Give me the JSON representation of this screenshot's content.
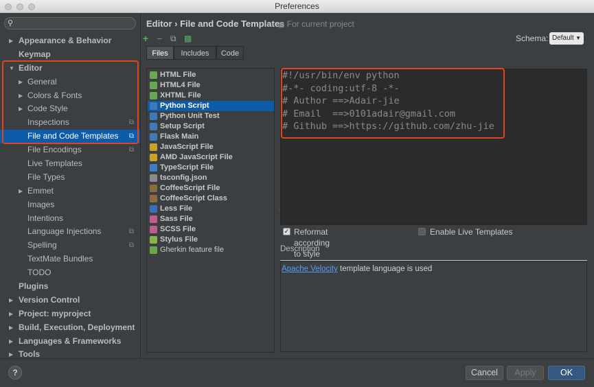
{
  "window": {
    "title": "Preferences"
  },
  "search": {
    "placeholder": ""
  },
  "tree": [
    {
      "label": "Appearance & Behavior",
      "indent": 0,
      "arrow": "▶",
      "bold": true
    },
    {
      "label": "Keymap",
      "indent": 0,
      "arrow": "",
      "bold": true
    },
    {
      "label": "Editor",
      "indent": 0,
      "arrow": "▼",
      "bold": true
    },
    {
      "label": "General",
      "indent": 1,
      "arrow": "▶"
    },
    {
      "label": "Colors & Fonts",
      "indent": 1,
      "arrow": "▶"
    },
    {
      "label": "Code Style",
      "indent": 1,
      "arrow": "▶"
    },
    {
      "label": "Inspections",
      "indent": 1,
      "arrow": "",
      "project": true
    },
    {
      "label": "File and Code Templates",
      "indent": 1,
      "arrow": "",
      "project": true,
      "selected": true
    },
    {
      "label": "File Encodings",
      "indent": 1,
      "arrow": "",
      "project": true
    },
    {
      "label": "Live Templates",
      "indent": 1,
      "arrow": ""
    },
    {
      "label": "File Types",
      "indent": 1,
      "arrow": ""
    },
    {
      "label": "Emmet",
      "indent": 1,
      "arrow": "▶"
    },
    {
      "label": "Images",
      "indent": 1,
      "arrow": ""
    },
    {
      "label": "Intentions",
      "indent": 1,
      "arrow": ""
    },
    {
      "label": "Language Injections",
      "indent": 1,
      "arrow": "",
      "project": true
    },
    {
      "label": "Spelling",
      "indent": 1,
      "arrow": "",
      "project": true
    },
    {
      "label": "TextMate Bundles",
      "indent": 1,
      "arrow": ""
    },
    {
      "label": "TODO",
      "indent": 1,
      "arrow": ""
    },
    {
      "label": "Plugins",
      "indent": 0,
      "arrow": "",
      "bold": true
    },
    {
      "label": "Version Control",
      "indent": 0,
      "arrow": "▶",
      "bold": true
    },
    {
      "label": "Project: myproject",
      "indent": 0,
      "arrow": "▶",
      "bold": true
    },
    {
      "label": "Build, Execution, Deployment",
      "indent": 0,
      "arrow": "▶",
      "bold": true
    },
    {
      "label": "Languages & Frameworks",
      "indent": 0,
      "arrow": "▶",
      "bold": true
    },
    {
      "label": "Tools",
      "indent": 0,
      "arrow": "▶",
      "bold": true
    }
  ],
  "header": {
    "breadcrumb": "Editor › File and Code Templates",
    "scope": "For current project"
  },
  "schema": {
    "label": "Schema:",
    "value": "Default"
  },
  "tabs": [
    {
      "label": "Files",
      "active": true
    },
    {
      "label": "Includes"
    },
    {
      "label": "Code"
    }
  ],
  "files": [
    {
      "label": "HTML File",
      "color": "#6aa84f"
    },
    {
      "label": "HTML4 File",
      "color": "#6aa84f"
    },
    {
      "label": "XHTML File",
      "color": "#6aa84f"
    },
    {
      "label": "Python Script",
      "color": "#3d7ab8",
      "selected": true
    },
    {
      "label": "Python Unit Test",
      "color": "#3d7ab8"
    },
    {
      "label": "Setup Script",
      "color": "#3d7ab8"
    },
    {
      "label": "Flask Main",
      "color": "#3d7ab8"
    },
    {
      "label": "JavaScript File",
      "color": "#c9a227"
    },
    {
      "label": "AMD JavaScript File",
      "color": "#c9a227"
    },
    {
      "label": "TypeScript File",
      "color": "#3b80c6"
    },
    {
      "label": "tsconfig.json",
      "color": "#8a8a8a"
    },
    {
      "label": "CoffeeScript File",
      "color": "#8a6d3b"
    },
    {
      "label": "CoffeeScript Class",
      "color": "#8a6d3b"
    },
    {
      "label": "Less File",
      "color": "#3b6fb5"
    },
    {
      "label": "Sass File",
      "color": "#c25b8e"
    },
    {
      "label": "SCSS File",
      "color": "#c25b8e"
    },
    {
      "label": "Stylus File",
      "color": "#8bb34a"
    },
    {
      "label": "Gherkin feature file",
      "color": "#6aa84f",
      "normal": true
    }
  ],
  "code_lines": [
    "#!/usr/bin/env python",
    "#-*- coding:utf-8 -*-",
    "# Author ==>Adair-jie",
    "# Email  ==>0101adair@gmail.com",
    "# Github ==>https://github.com/zhu-jie"
  ],
  "options": {
    "reformat": "Reformat according to style",
    "reformat_checked": true,
    "live": "Enable Live Templates",
    "live_checked": false
  },
  "description": {
    "label": "Description",
    "link": "Apache Velocity",
    "text": " template language is used"
  },
  "buttons": {
    "help": "?",
    "cancel": "Cancel",
    "apply": "Apply",
    "ok": "OK"
  },
  "colors": {
    "selection": "#0d5ca7",
    "highlight": "#e5431c"
  }
}
